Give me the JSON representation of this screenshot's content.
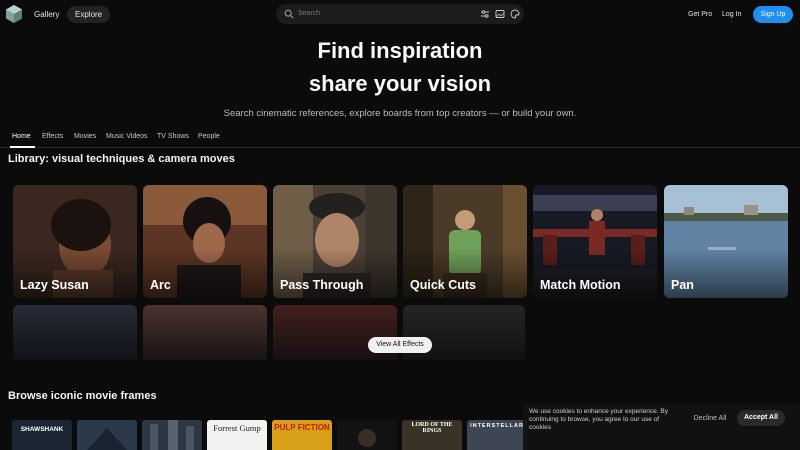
{
  "nav": {
    "links": [
      "Gallery",
      "Explore"
    ],
    "search_placeholder": "Search",
    "get_pro": "Get Pro",
    "log_in": "Log In",
    "sign_up": "Sign Up"
  },
  "hero": {
    "line1": "Find inspiration",
    "line2": "share your vision",
    "subtitle": "Search cinematic references, explore boards from top creators — or build your own."
  },
  "tabs": [
    "Home",
    "Effects",
    "Movies",
    "Music Videos",
    "TV Shows",
    "People"
  ],
  "library": {
    "title": "Library: visual techniques & camera moves",
    "cards": [
      "Lazy Susan",
      "Arc",
      "Pass Through",
      "Quick Cuts",
      "Match Motion",
      "Pan"
    ],
    "view_all": "View All Effects"
  },
  "movies": {
    "title": "Browse iconic movie frames",
    "frames": [
      "SHAWSHANK",
      "",
      "",
      "Forrest Gump",
      "PULP FICTION",
      "",
      "LORD OF THE RINGS",
      "INTERSTELLAR"
    ]
  },
  "cookie": {
    "text": "We use cookies to enhance your experience. By continuing to browse, you agree to our use of cookies",
    "decline": "Decline All",
    "accept": "Accept All"
  },
  "colors": {
    "accent": "#1f8ef1",
    "background": "#0b0b0c"
  }
}
